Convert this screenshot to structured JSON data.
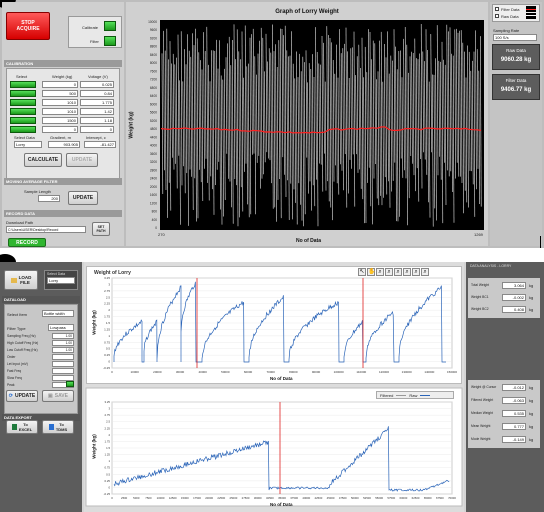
{
  "top": {
    "stop_label": "STOP\nACQUIRE",
    "calibrate_label": "Calibrate",
    "filter_label": "Filter",
    "calibration_header": "CALIBRATION",
    "table_headers": [
      "Select",
      "Weight (kg)",
      "Voltage (V)"
    ],
    "weights": [
      "0",
      "500",
      "1010",
      "1010",
      "1500",
      "0"
    ],
    "voltages": [
      "0.025",
      "0.84",
      "1.775",
      "1.42",
      "1.18",
      "0"
    ],
    "select_data_label": "Select Data",
    "select_data_value": "Lorry",
    "gradient_label": "Gradient, m",
    "gradient_value": "903.905",
    "intercept_label": "Intercept, c",
    "intercept_value": "-81.427",
    "calculate_label": "CALCULATE",
    "update_label": "UPDATE",
    "moving_header": "MOVING AVERAGE FILTER",
    "sample_length_label": "Sample Length",
    "sample_length_value": "200",
    "update2_label": "UPDATE",
    "record_header": "RECORD DATA",
    "download_label": "Download Path",
    "download_value": "C:\\Users\\USER\\Desktop\\Record",
    "set_path_label": "SET PATH",
    "record_label": "RECORD",
    "chart_title": "Graph of Lorry Weight",
    "xlabel": "No of Data",
    "ylabel": "Weight (kg)",
    "x_start": "270",
    "x_end": "1269",
    "yticks": [
      "10000",
      "9600",
      "9200",
      "8800",
      "8400",
      "8000",
      "7600",
      "7200",
      "6800",
      "6400",
      "6000",
      "5600",
      "5200",
      "4800",
      "4400",
      "4000",
      "3600",
      "3200",
      "2800",
      "2400",
      "2000",
      "1600",
      "1200",
      "800",
      "400",
      "0"
    ],
    "legend_filter": "Filter Data",
    "legend_raw": "Raw Data",
    "sampling_label": "Sampling Rate",
    "sampling_value": "100 S/s",
    "raw_label": "Raw Data",
    "raw_value": "9060.28  kg",
    "filter_data_label": "Filter Data",
    "filter_data_value": "9406.77  kg"
  },
  "bottom": {
    "load_label": "LOAD\nFILE",
    "select_mode_label": "Select Data",
    "select_mode_value": "Lorry",
    "dataload_header": "DATALOAD",
    "select_item_label": "Select Item",
    "select_item_value": "Bottle width",
    "filter_type_label": "Filter Type",
    "filter_type_value": "Lowpass",
    "rows": [
      [
        "Sampling Freq (Hz)",
        "1.00"
      ],
      [
        "High Cutoff Freq (Hz)",
        "1.00"
      ],
      [
        "Low Cutoff Freq (Hz)",
        "1.00"
      ],
      [
        "Order",
        ""
      ],
      [
        "Let Input (mV)",
        ""
      ],
      [
        "Fast Freq",
        ""
      ],
      [
        "Slow Freq",
        ""
      ],
      [
        "Peak",
        ""
      ]
    ],
    "update_label": "UPDATE",
    "save_label": "SAVE",
    "dataexport_header": "DATA EXPORT",
    "excel_label": "To\nEXCEL",
    "tdms_label": "To\nTDMS",
    "chart1_title": "Weight of Lorry",
    "chart1_xlabel": "No of Data",
    "chart1_ylabel": "Weight (kg)",
    "chart1_xticks": [
      "0",
      "10000",
      "20000",
      "30000",
      "40000",
      "50000",
      "60000",
      "70000",
      "80000",
      "90000",
      "100000",
      "110000",
      "120000",
      "130000",
      "140000",
      "150000"
    ],
    "chart1_yticks": [
      "3.25",
      "3",
      "2.75",
      "2.5",
      "2.25",
      "2",
      "1.75",
      "1.5",
      "1.25",
      "1",
      "0.75",
      "0.5",
      "0.25",
      "0",
      "-0.25"
    ],
    "chart2_xlabel": "No of Data",
    "chart2_ylabel": "Weight (kg)",
    "chart2_legend1": "Filtered",
    "chart2_legend2": "Raw",
    "chart2_xticks": [
      "0",
      "2500",
      "5000",
      "7500",
      "10000",
      "12500",
      "15000",
      "17500",
      "20000",
      "22500",
      "25000",
      "27500",
      "30000",
      "32500",
      "35000",
      "37500",
      "40000",
      "42500",
      "45000",
      "47500",
      "50000",
      "52500",
      "55000",
      "57500",
      "60000",
      "62500",
      "65000",
      "67500",
      "70000"
    ],
    "chart2_yticks": [
      "3.25",
      "3",
      "2.75",
      "2.5",
      "2.25",
      "2",
      "1.75",
      "1.5",
      "1.25",
      "1",
      "0.75",
      "0.5",
      "0.25",
      "0",
      "-0.25"
    ],
    "analysis_header": "DATA ANALYSIS - LORRY",
    "analysis": [
      [
        "Total Weight",
        "3.064",
        "kg"
      ],
      [
        "Weight BC1",
        "-0.002",
        "kg"
      ],
      [
        "Weight BC2",
        "0.408",
        "kg"
      ]
    ],
    "analysis2": [
      [
        "Weight @ Cursor",
        "-0.012",
        "kg"
      ],
      [
        "Filtered Weight",
        "-0.063",
        "kg"
      ],
      [
        "Median Weight",
        "0.535",
        "kg"
      ],
      [
        "Mean Weight",
        "0.777",
        "kg"
      ],
      [
        "Mode Weight",
        "-0.149",
        "kg"
      ]
    ]
  }
}
